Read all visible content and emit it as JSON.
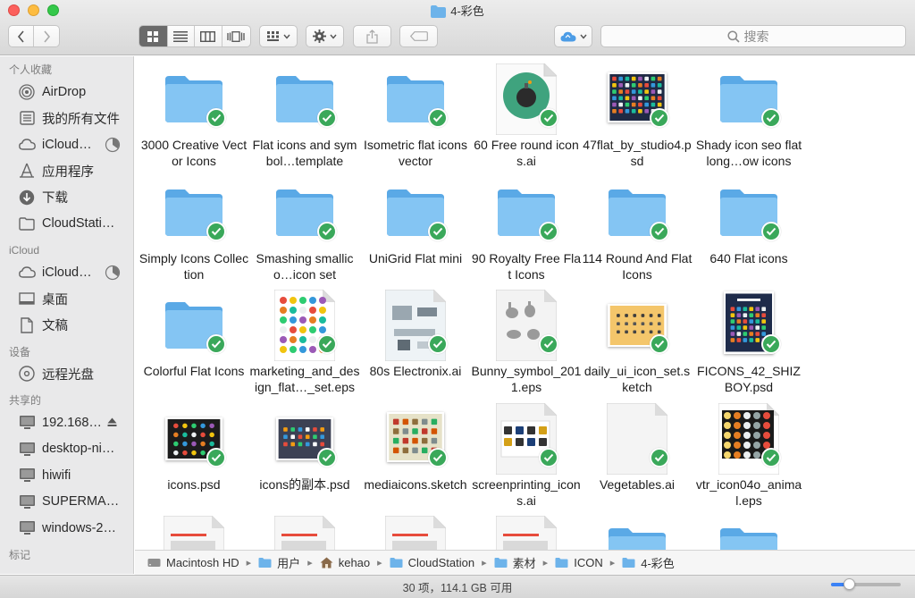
{
  "window": {
    "title": "4-彩色"
  },
  "toolbar": {
    "back": "back",
    "forward": "forward",
    "views": [
      "icon-view",
      "list-view",
      "column-view",
      "coverflow-view"
    ],
    "arrange": "arrange",
    "action": "action",
    "share": "share",
    "tags": "tags",
    "cloud": "icloud",
    "search_placeholder": "搜索"
  },
  "sidebar": {
    "sections": [
      {
        "header": "个人收藏",
        "items": [
          {
            "label": "AirDrop",
            "icon": "airdrop-icon"
          },
          {
            "label": "我的所有文件",
            "icon": "all-files-icon"
          },
          {
            "label": "iCloud…",
            "icon": "icloud-icon",
            "progress": 0.35
          },
          {
            "label": "应用程序",
            "icon": "applications-icon"
          },
          {
            "label": "下载",
            "icon": "downloads-icon"
          },
          {
            "label": "CloudStati…",
            "icon": "folder-icon"
          }
        ]
      },
      {
        "header": "iCloud",
        "items": [
          {
            "label": "iCloud…",
            "icon": "icloud-icon",
            "progress": 0.35
          },
          {
            "label": "桌面",
            "icon": "desktop-icon"
          },
          {
            "label": "文稿",
            "icon": "documents-icon"
          }
        ]
      },
      {
        "header": "设备",
        "items": [
          {
            "label": "远程光盘",
            "icon": "remote-disc-icon"
          }
        ]
      },
      {
        "header": "共享的",
        "items": [
          {
            "label": "192.168…",
            "icon": "computer-icon",
            "eject": true
          },
          {
            "label": "desktop-ni…",
            "icon": "computer-icon"
          },
          {
            "label": "hiwifi",
            "icon": "computer-icon"
          },
          {
            "label": "SUPERMA…",
            "icon": "computer-icon"
          },
          {
            "label": "windows-2…",
            "icon": "computer-icon"
          }
        ]
      },
      {
        "header": "标记",
        "items": []
      }
    ]
  },
  "files": [
    {
      "name": "3000 Creative Vector Icons",
      "kind": "folder"
    },
    {
      "name": "Flat icons and symbol…template",
      "kind": "folder"
    },
    {
      "name": "Isometric flat icons vector",
      "kind": "folder"
    },
    {
      "name": "60 Free round icons.ai",
      "kind": "round-icon-doc"
    },
    {
      "name": "47flat_by_studio4.psd",
      "kind": "dark-icons-photo"
    },
    {
      "name": "Shady icon seo flat long…ow icons",
      "kind": "folder"
    },
    {
      "name": "Simply Icons Collection",
      "kind": "folder"
    },
    {
      "name": "Smashing smallico…icon set",
      "kind": "folder"
    },
    {
      "name": "UniGrid Flat mini",
      "kind": "folder"
    },
    {
      "name": "90 Royalty Free Flat Icons",
      "kind": "folder"
    },
    {
      "name": "114 Round And Flat Icons",
      "kind": "folder"
    },
    {
      "name": "640 Flat icons",
      "kind": "folder"
    },
    {
      "name": "Colorful Flat Icons",
      "kind": "folder"
    },
    {
      "name": "marketing_and_design_flat…_set.eps",
      "kind": "color-dots-doc"
    },
    {
      "name": "80s Electronix.ai",
      "kind": "electronics-doc"
    },
    {
      "name": "Bunny_symbol_2011.eps",
      "kind": "bunny-doc"
    },
    {
      "name": "daily_ui_icon_set.sketch",
      "kind": "yellow-photo"
    },
    {
      "name": "FICONS_42_SHIZBOY.psd",
      "kind": "poster-photo"
    },
    {
      "name": "icons.psd",
      "kind": "dark-small-photo"
    },
    {
      "name": "icons的副本.psd",
      "kind": "slate-photo"
    },
    {
      "name": "mediaicons.sketch",
      "kind": "media-photo"
    },
    {
      "name": "screenprinting_icons.ai",
      "kind": "screenprint-doc"
    },
    {
      "name": "Vegetables.ai",
      "kind": "blank-doc"
    },
    {
      "name": "vtr_icon04o_animal.eps",
      "kind": "animal-doc"
    },
    {
      "name": "",
      "kind": "partial-doc"
    },
    {
      "name": "",
      "kind": "partial-doc"
    },
    {
      "name": "",
      "kind": "partial-doc"
    },
    {
      "name": "",
      "kind": "partial-doc"
    },
    {
      "name": "",
      "kind": "partial-folder"
    },
    {
      "name": "",
      "kind": "partial-folder"
    }
  ],
  "pathbar": [
    {
      "label": "Macintosh HD",
      "icon": "hard-disk-icon"
    },
    {
      "label": "用户",
      "icon": "folder-icon"
    },
    {
      "label": "kehao",
      "icon": "home-icon"
    },
    {
      "label": "CloudStation",
      "icon": "folder-icon"
    },
    {
      "label": "素材",
      "icon": "folder-icon"
    },
    {
      "label": "ICON",
      "icon": "folder-icon"
    },
    {
      "label": "4-彩色",
      "icon": "folder-icon"
    }
  ],
  "status": {
    "text": "30 项，114.1 GB 可用",
    "zoom": 0.25
  },
  "colors": {
    "folder": "#79bff0",
    "badge": "#3aa85a",
    "sidebar_bg": "#e9e9ea"
  }
}
